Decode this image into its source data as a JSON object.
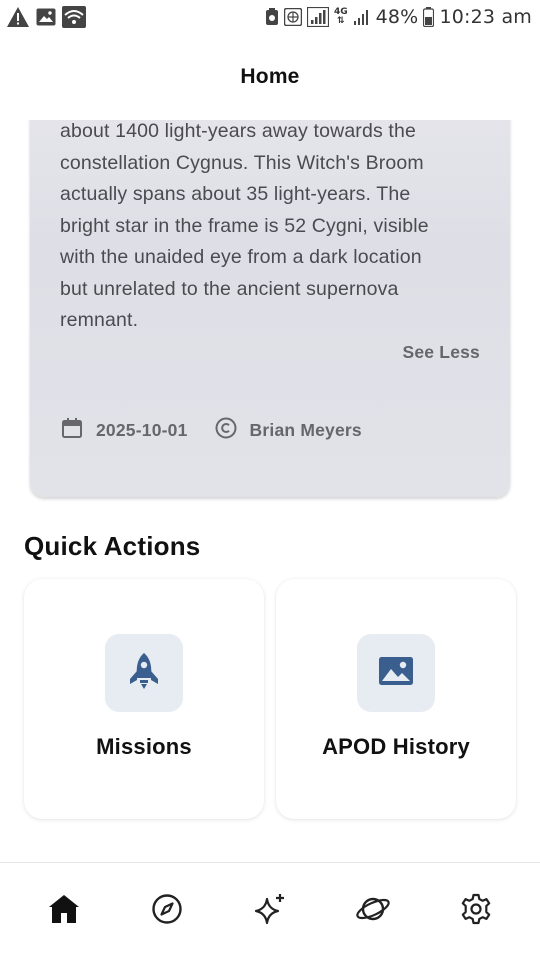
{
  "status_bar": {
    "battery": "48%",
    "time": "10:23 am",
    "network_label": "4G"
  },
  "app_bar": {
    "title": "Home"
  },
  "apod_card": {
    "description_lines": [
      "about 1400 light-years away towards the",
      "constellation Cygnus. This Witch's Broom",
      "actually spans about 35 light-years. The",
      "bright star in the frame is 52 Cygni, visible",
      "with the unaided eye from a dark location",
      "but unrelated to the ancient supernova",
      "remnant."
    ],
    "see_less_label": "See Less",
    "date": "2025-10-01",
    "copyright": "Brian Meyers"
  },
  "quick_actions": {
    "title": "Quick Actions",
    "items": [
      {
        "label": "Missions",
        "icon": "rocket-icon"
      },
      {
        "label": "APOD History",
        "icon": "image-icon"
      }
    ]
  },
  "bottom_nav": {
    "items": [
      {
        "icon": "home-icon",
        "active": true
      },
      {
        "icon": "compass-icon",
        "active": false
      },
      {
        "icon": "sparkles-icon",
        "active": false
      },
      {
        "icon": "planet-icon",
        "active": false
      },
      {
        "icon": "settings-icon",
        "active": false
      }
    ]
  },
  "colors": {
    "accent": "#3a5f8f",
    "icon_box_bg": "#e7ecf2",
    "card_bg": "#e2e2e9"
  }
}
